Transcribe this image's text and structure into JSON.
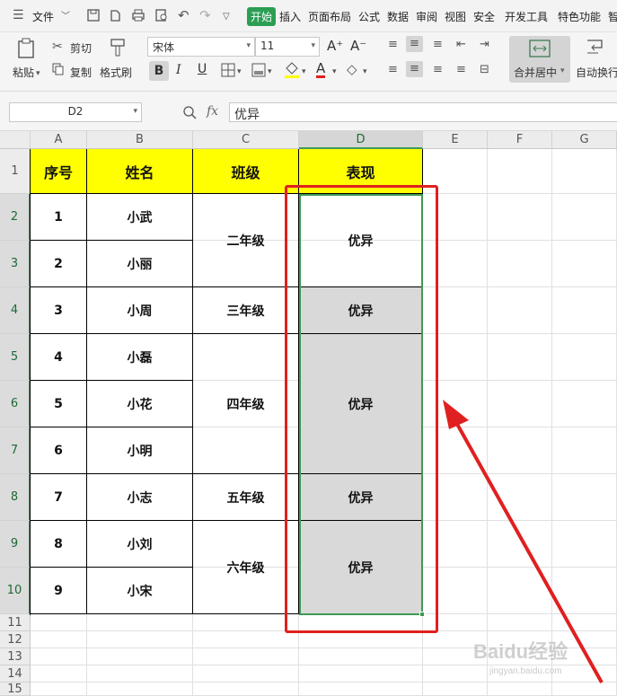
{
  "menubar": {
    "file": "文件",
    "tabs": [
      "开始",
      "插入",
      "页面布局",
      "公式",
      "数据",
      "审阅",
      "视图",
      "安全",
      "开发工具",
      "特色功能",
      "智"
    ]
  },
  "ribbon": {
    "paste": "粘贴",
    "cut": "剪切",
    "copy": "复制",
    "format_painter": "格式刷",
    "font_name": "宋体",
    "font_size": "11",
    "bold": "B",
    "italic": "I",
    "underline": "U",
    "font_grow": "A⁺",
    "font_shrink": "A⁻",
    "font_color_letter": "A",
    "merge_center": "合并居中",
    "auto_wrap": "自动换行"
  },
  "formula_bar": {
    "name_box": "D2",
    "fx": "fx",
    "content": "优异"
  },
  "columns": [
    "A",
    "B",
    "C",
    "D",
    "E",
    "F",
    "G"
  ],
  "rows": [
    "1",
    "2",
    "3",
    "4",
    "5",
    "6",
    "7",
    "8",
    "9",
    "10",
    "11",
    "12",
    "13",
    "14",
    "15"
  ],
  "table": {
    "headers": [
      "序号",
      "姓名",
      "班级",
      "表现"
    ],
    "rows": [
      {
        "num": "1",
        "name": "小武"
      },
      {
        "num": "2",
        "name": "小丽"
      },
      {
        "num": "3",
        "name": "小周"
      },
      {
        "num": "4",
        "name": "小磊"
      },
      {
        "num": "5",
        "name": "小花"
      },
      {
        "num": "6",
        "name": "小明"
      },
      {
        "num": "7",
        "name": "小志"
      },
      {
        "num": "8",
        "name": "小刘"
      },
      {
        "num": "9",
        "name": "小宋"
      }
    ],
    "classes": [
      "二年级",
      "三年级",
      "四年级",
      "五年级",
      "六年级"
    ],
    "performance": [
      "优异",
      "优异",
      "优异",
      "优异",
      "优异"
    ]
  },
  "watermark": {
    "brand": "Baidu经验",
    "url": "jingyan.baidu.com"
  },
  "colors": {
    "header_fill": "#ffff00",
    "selection_fill": "#d9d9d9",
    "annotation_red": "#e02020",
    "active_tab": "#2b9e54"
  }
}
